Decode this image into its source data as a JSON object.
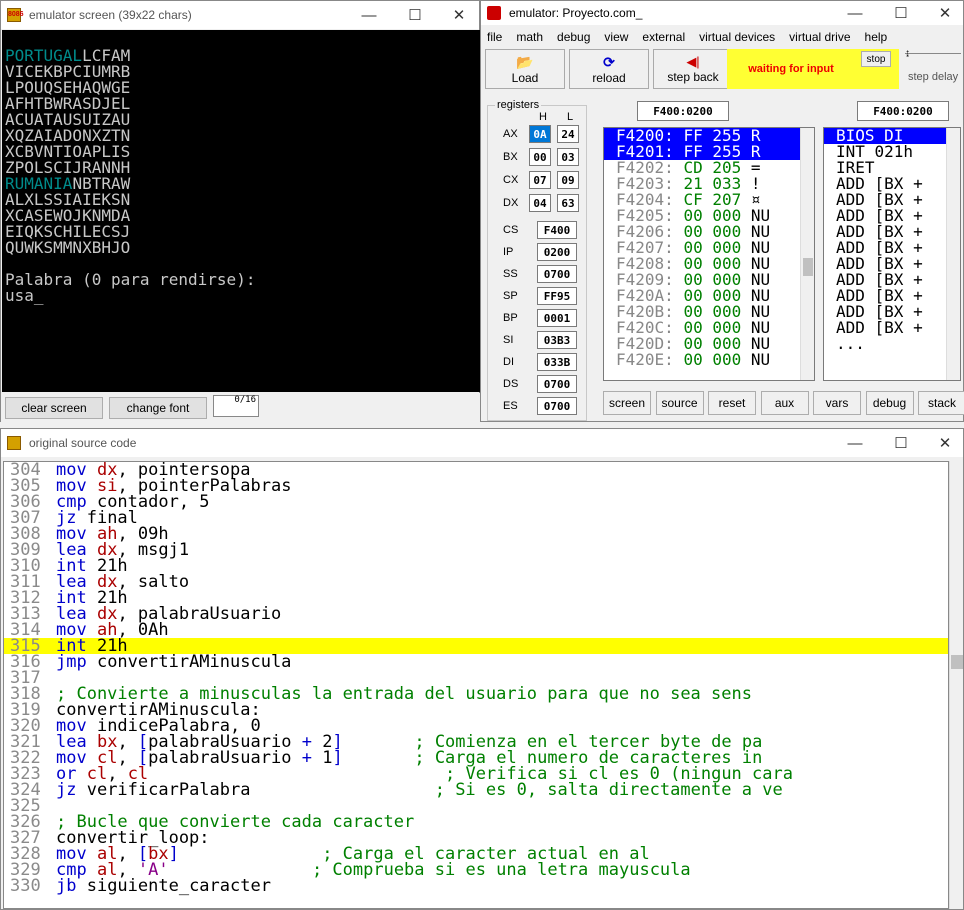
{
  "screen_window": {
    "title": "emulator screen (39x22 chars)",
    "rows": [
      {
        "segments": [
          {
            "t": "PORTUGAL",
            "c": "cy"
          },
          {
            "t": "LCFAM",
            "c": ""
          }
        ]
      },
      {
        "segments": [
          {
            "t": "VICEKBPCIUMRB",
            "c": ""
          }
        ]
      },
      {
        "segments": [
          {
            "t": "LPOUQSEHAQWGE",
            "c": ""
          }
        ]
      },
      {
        "segments": [
          {
            "t": "AFHTBWRASDJEL",
            "c": ""
          }
        ]
      },
      {
        "segments": [
          {
            "t": "ACUATAUSUIZAU",
            "c": ""
          }
        ]
      },
      {
        "segments": [
          {
            "t": "XQZAIADONXZTN",
            "c": ""
          }
        ]
      },
      {
        "segments": [
          {
            "t": "XCBVNTIOAPLIS",
            "c": ""
          }
        ]
      },
      {
        "segments": [
          {
            "t": "ZPOLSCIJRANNH",
            "c": ""
          }
        ]
      },
      {
        "segments": [
          {
            "t": "RUMANIA",
            "c": "cy"
          },
          {
            "t": "NBTRAW",
            "c": ""
          }
        ]
      },
      {
        "segments": [
          {
            "t": "ALXLSSIAIEKSN",
            "c": ""
          }
        ]
      },
      {
        "segments": [
          {
            "t": "XCASEWOJKNMDA",
            "c": ""
          }
        ]
      },
      {
        "segments": [
          {
            "t": "EIQKSCHILECSJ",
            "c": ""
          }
        ]
      },
      {
        "segments": [
          {
            "t": "QUWKSMMNXBHJO",
            "c": ""
          }
        ]
      },
      {
        "segments": [
          {
            "t": "",
            "c": ""
          }
        ]
      },
      {
        "segments": [
          {
            "t": "Palabra (0 para rendirse):",
            "c": ""
          }
        ]
      },
      {
        "segments": [
          {
            "t": "usa_",
            "c": ""
          }
        ]
      }
    ],
    "clear_label": "clear screen",
    "font_label": "change font",
    "counter": "0/16"
  },
  "emulator": {
    "title": "emulator: Proyecto.com_",
    "menu": [
      "file",
      "math",
      "debug",
      "view",
      "external",
      "virtual devices",
      "virtual drive",
      "help"
    ],
    "load_label": "Load",
    "reload_label": "reload",
    "step_back_label": "step back",
    "status": "waiting for input",
    "stop_label": "stop",
    "step_delay_label": "step delay",
    "registers_label": "registers",
    "h_label": "H",
    "l_label": "L",
    "regs_hl": [
      {
        "name": "AX",
        "h": "0A",
        "l": "24"
      },
      {
        "name": "BX",
        "h": "00",
        "l": "03"
      },
      {
        "name": "CX",
        "h": "07",
        "l": "09"
      },
      {
        "name": "DX",
        "h": "04",
        "l": "63"
      }
    ],
    "regs_16": [
      {
        "name": "CS",
        "v": "F400"
      },
      {
        "name": "IP",
        "v": "0200"
      },
      {
        "name": "SS",
        "v": "0700"
      },
      {
        "name": "SP",
        "v": "FF95"
      },
      {
        "name": "BP",
        "v": "0001"
      },
      {
        "name": "SI",
        "v": "03B3"
      },
      {
        "name": "DI",
        "v": "033B"
      },
      {
        "name": "DS",
        "v": "0700"
      },
      {
        "name": "ES",
        "v": "0700"
      }
    ],
    "addr_left": "F400:0200",
    "addr_right": "F400:0200",
    "memory": [
      {
        "a": "F4200:",
        "h": "FF",
        "d": "255",
        "c": "R",
        "sel": true
      },
      {
        "a": "F4201:",
        "h": "FF",
        "d": "255",
        "c": "R",
        "sel": true
      },
      {
        "a": "F4202:",
        "h": "CD",
        "d": "205",
        "c": "=",
        "sel": false
      },
      {
        "a": "F4203:",
        "h": "21",
        "d": "033",
        "c": "!",
        "sel": false
      },
      {
        "a": "F4204:",
        "h": "CF",
        "d": "207",
        "c": "¤",
        "sel": false
      },
      {
        "a": "F4205:",
        "h": "00",
        "d": "000",
        "c": "NU",
        "sel": false
      },
      {
        "a": "F4206:",
        "h": "00",
        "d": "000",
        "c": "NU",
        "sel": false
      },
      {
        "a": "F4207:",
        "h": "00",
        "d": "000",
        "c": "NU",
        "sel": false
      },
      {
        "a": "F4208:",
        "h": "00",
        "d": "000",
        "c": "NU",
        "sel": false
      },
      {
        "a": "F4209:",
        "h": "00",
        "d": "000",
        "c": "NU",
        "sel": false
      },
      {
        "a": "F420A:",
        "h": "00",
        "d": "000",
        "c": "NU",
        "sel": false
      },
      {
        "a": "F420B:",
        "h": "00",
        "d": "000",
        "c": "NU",
        "sel": false
      },
      {
        "a": "F420C:",
        "h": "00",
        "d": "000",
        "c": "NU",
        "sel": false
      },
      {
        "a": "F420D:",
        "h": "00",
        "d": "000",
        "c": "NU",
        "sel": false
      },
      {
        "a": "F420E:",
        "h": "00",
        "d": "000",
        "c": "NU",
        "sel": false
      }
    ],
    "disasm": [
      {
        "t": "BIOS DI",
        "sel": true
      },
      {
        "t": "INT 021h",
        "sel": false
      },
      {
        "t": "IRET",
        "sel": false
      },
      {
        "t": "ADD [BX +",
        "sel": false
      },
      {
        "t": "ADD [BX +",
        "sel": false
      },
      {
        "t": "ADD [BX +",
        "sel": false
      },
      {
        "t": "ADD [BX +",
        "sel": false
      },
      {
        "t": "ADD [BX +",
        "sel": false
      },
      {
        "t": "ADD [BX +",
        "sel": false
      },
      {
        "t": "ADD [BX +",
        "sel": false
      },
      {
        "t": "ADD [BX +",
        "sel": false
      },
      {
        "t": "ADD [BX +",
        "sel": false
      },
      {
        "t": "ADD [BX +",
        "sel": false
      },
      {
        "t": "...",
        "sel": false
      }
    ],
    "bottom_buttons": [
      "screen",
      "source",
      "reset",
      "aux",
      "vars",
      "debug",
      "stack"
    ]
  },
  "source": {
    "title": "original source code",
    "lines": [
      {
        "n": "304",
        "hl": false,
        "p": [
          {
            "t": "mov ",
            "c": "kw"
          },
          {
            "t": "dx",
            "c": "rg"
          },
          {
            "t": ", pointersopa",
            "c": ""
          }
        ]
      },
      {
        "n": "305",
        "hl": false,
        "p": [
          {
            "t": "mov ",
            "c": "kw"
          },
          {
            "t": "si",
            "c": "rg"
          },
          {
            "t": ", pointerPalabras",
            "c": ""
          }
        ]
      },
      {
        "n": "306",
        "hl": false,
        "p": [
          {
            "t": "cmp ",
            "c": "kw"
          },
          {
            "t": "contador, 5",
            "c": ""
          }
        ]
      },
      {
        "n": "307",
        "hl": false,
        "p": [
          {
            "t": "jz ",
            "c": "kw"
          },
          {
            "t": "final",
            "c": ""
          }
        ]
      },
      {
        "n": "308",
        "hl": false,
        "p": [
          {
            "t": "mov ",
            "c": "kw"
          },
          {
            "t": "ah",
            "c": "rg"
          },
          {
            "t": ", 09h",
            "c": ""
          }
        ]
      },
      {
        "n": "309",
        "hl": false,
        "p": [
          {
            "t": "lea ",
            "c": "kw"
          },
          {
            "t": "dx",
            "c": "rg"
          },
          {
            "t": ", msgj1",
            "c": ""
          }
        ]
      },
      {
        "n": "310",
        "hl": false,
        "p": [
          {
            "t": "int ",
            "c": "kw"
          },
          {
            "t": "21h",
            "c": ""
          }
        ]
      },
      {
        "n": "311",
        "hl": false,
        "p": [
          {
            "t": "lea ",
            "c": "kw"
          },
          {
            "t": "dx",
            "c": "rg"
          },
          {
            "t": ", salto",
            "c": ""
          }
        ]
      },
      {
        "n": "312",
        "hl": false,
        "p": [
          {
            "t": "int ",
            "c": "kw"
          },
          {
            "t": "21h",
            "c": ""
          }
        ]
      },
      {
        "n": "313",
        "hl": false,
        "p": [
          {
            "t": "lea ",
            "c": "kw"
          },
          {
            "t": "dx",
            "c": "rg"
          },
          {
            "t": ", palabraUsuario",
            "c": ""
          }
        ]
      },
      {
        "n": "314",
        "hl": false,
        "p": [
          {
            "t": "mov ",
            "c": "kw"
          },
          {
            "t": "ah",
            "c": "rg"
          },
          {
            "t": ", 0Ah",
            "c": ""
          }
        ]
      },
      {
        "n": "315",
        "hl": true,
        "p": [
          {
            "t": "int ",
            "c": "kw"
          },
          {
            "t": "21h",
            "c": ""
          }
        ]
      },
      {
        "n": "316",
        "hl": false,
        "p": [
          {
            "t": "jmp ",
            "c": "kw"
          },
          {
            "t": "convertirAMinuscula",
            "c": ""
          }
        ]
      },
      {
        "n": "317",
        "hl": false,
        "p": [
          {
            "t": "",
            "c": ""
          }
        ]
      },
      {
        "n": "318",
        "hl": false,
        "p": [
          {
            "t": "; Convierte a minusculas la entrada del usuario para que no sea sens",
            "c": "cm"
          }
        ]
      },
      {
        "n": "319",
        "hl": false,
        "p": [
          {
            "t": "convertirAMinuscula:",
            "c": ""
          }
        ]
      },
      {
        "n": "320",
        "hl": false,
        "p": [
          {
            "t": "mov ",
            "c": "kw"
          },
          {
            "t": "indicePalabra, 0",
            "c": ""
          }
        ]
      },
      {
        "n": "321",
        "hl": false,
        "p": [
          {
            "t": "lea ",
            "c": "kw"
          },
          {
            "t": "bx",
            "c": "rg"
          },
          {
            "t": ", ",
            "c": ""
          },
          {
            "t": "[",
            "c": "kw"
          },
          {
            "t": "palabraUsuario ",
            "c": ""
          },
          {
            "t": "+",
            "c": "kw"
          },
          {
            "t": " 2",
            "c": ""
          },
          {
            "t": "]",
            "c": "kw"
          },
          {
            "t": "       ",
            "c": ""
          },
          {
            "t": "; Comienza en el tercer byte de pa",
            "c": "cm"
          }
        ]
      },
      {
        "n": "322",
        "hl": false,
        "p": [
          {
            "t": "mov ",
            "c": "kw"
          },
          {
            "t": "cl",
            "c": "rg"
          },
          {
            "t": ", ",
            "c": ""
          },
          {
            "t": "[",
            "c": "kw"
          },
          {
            "t": "palabraUsuario ",
            "c": ""
          },
          {
            "t": "+",
            "c": "kw"
          },
          {
            "t": " 1",
            "c": ""
          },
          {
            "t": "]",
            "c": "kw"
          },
          {
            "t": "       ",
            "c": ""
          },
          {
            "t": "; Carga el numero de caracteres in",
            "c": "cm"
          }
        ]
      },
      {
        "n": "323",
        "hl": false,
        "p": [
          {
            "t": "or ",
            "c": "kw"
          },
          {
            "t": "cl",
            "c": "rg"
          },
          {
            "t": ", ",
            "c": ""
          },
          {
            "t": "cl",
            "c": "rg"
          },
          {
            "t": "                             ",
            "c": ""
          },
          {
            "t": "; Verifica si cl es 0 (ningun cara",
            "c": "cm"
          }
        ]
      },
      {
        "n": "324",
        "hl": false,
        "p": [
          {
            "t": "jz ",
            "c": "kw"
          },
          {
            "t": "verificarPalabra",
            "c": ""
          },
          {
            "t": "                  ",
            "c": ""
          },
          {
            "t": "; Si es 0, salta directamente a ve",
            "c": "cm"
          }
        ]
      },
      {
        "n": "325",
        "hl": false,
        "p": [
          {
            "t": "",
            "c": ""
          }
        ]
      },
      {
        "n": "326",
        "hl": false,
        "p": [
          {
            "t": "; Bucle que convierte cada caracter",
            "c": "cm"
          }
        ]
      },
      {
        "n": "327",
        "hl": false,
        "p": [
          {
            "t": "convertir_loop:",
            "c": ""
          }
        ]
      },
      {
        "n": "328",
        "hl": false,
        "p": [
          {
            "t": "mov ",
            "c": "kw"
          },
          {
            "t": "al",
            "c": "rg"
          },
          {
            "t": ", ",
            "c": ""
          },
          {
            "t": "[",
            "c": "kw"
          },
          {
            "t": "bx",
            "c": "rg"
          },
          {
            "t": "]",
            "c": "kw"
          },
          {
            "t": "              ",
            "c": ""
          },
          {
            "t": "; Carga el caracter actual en al",
            "c": "cm"
          }
        ]
      },
      {
        "n": "329",
        "hl": false,
        "p": [
          {
            "t": "cmp ",
            "c": "kw"
          },
          {
            "t": "al",
            "c": "rg"
          },
          {
            "t": ", ",
            "c": ""
          },
          {
            "t": "'A'",
            "c": "str"
          },
          {
            "t": "              ",
            "c": ""
          },
          {
            "t": "; Comprueba si es una letra mayuscula",
            "c": "cm"
          }
        ]
      },
      {
        "n": "330",
        "hl": false,
        "p": [
          {
            "t": "jb ",
            "c": "kw"
          },
          {
            "t": "siguiente_caracter",
            "c": ""
          }
        ]
      }
    ]
  }
}
